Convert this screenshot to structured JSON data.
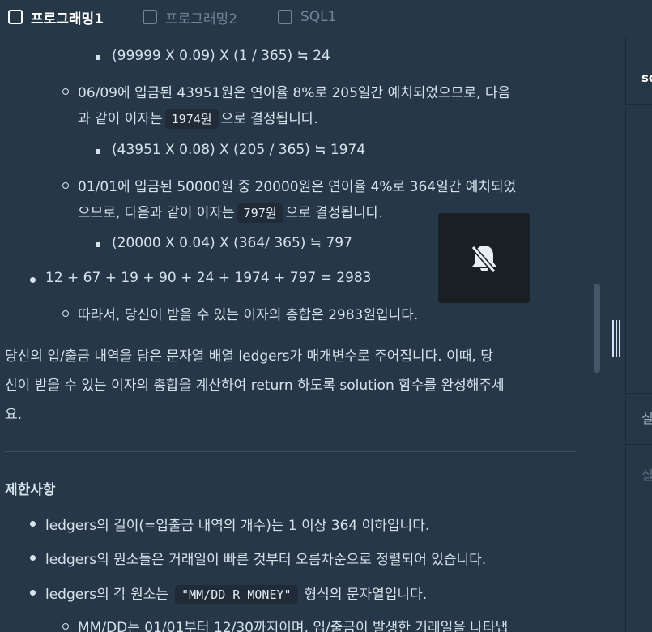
{
  "tabs": [
    {
      "label": "프로그래밍1"
    },
    {
      "label": "프로그래밍2"
    },
    {
      "label": "SQL1"
    }
  ],
  "content": {
    "calc_24": "(99999 X 0.09) X (1 / 365) ≒ 24",
    "p_0609_line1": "06/09에 입금된 43951원은 연이율 8%로 205일간 예치되었으므로, 다음",
    "p_0609_line2_pre": "과 같이 이자는",
    "p_0609_code": "1974원",
    "p_0609_line2_post": "으로 결정됩니다.",
    "calc_1974": "(43951 X 0.08) X (205 / 365) ≒ 1974",
    "p_0101_line1": "01/01에 입금된 50000원 중 20000원은 연이율 4%로 364일간 예치되었",
    "p_0101_line2_pre": "으므로, 다음과 같이 이자는",
    "p_0101_code": "797원",
    "p_0101_line2_post": "으로 결정됩니다.",
    "calc_797": "(20000 X 0.04) X (364/ 365) ≒ 797",
    "sum_line": "12 + 67 + 19 + 90 + 24 + 1974 + 797 = 2983",
    "conclusion": "따라서, 당신이 받을 수 있는 이자의 총합은 2983원입니다.",
    "desc_line1": "당신의 입/출금 내역을 담은 문자열 배열 ledgers가 매개변수로 주어집니다. 이때, 당",
    "desc_line2": "신이 받을 수 있는 이자의 총합을 계산하여 return 하도록 solution 함수를 완성해주세",
    "desc_line3": "요.",
    "restrictions_heading": "제한사항",
    "r1": "ledgers의 길이(=입출금 내역의 개수)는 1 이상 364 이하입니다.",
    "r2": "ledgers의 원소들은 거래일이 빠른 것부터 오름차순으로 정렬되어 있습니다.",
    "r3_pre": "ledgers의 각 원소는",
    "r3_code": "\"MM/DD R MONEY\"",
    "r3_post": "형식의 문자열입니다.",
    "r4_partial": "MM/DD는 01/01부터 12/30까지이며, 입/출금이 발생한 거래일을 나타냅"
  },
  "overlay": {
    "icon": "bell-off-icon"
  },
  "right_pane": {
    "title_fragment": "so",
    "result_fragment": "실",
    "result_sub_fragment": "실"
  }
}
